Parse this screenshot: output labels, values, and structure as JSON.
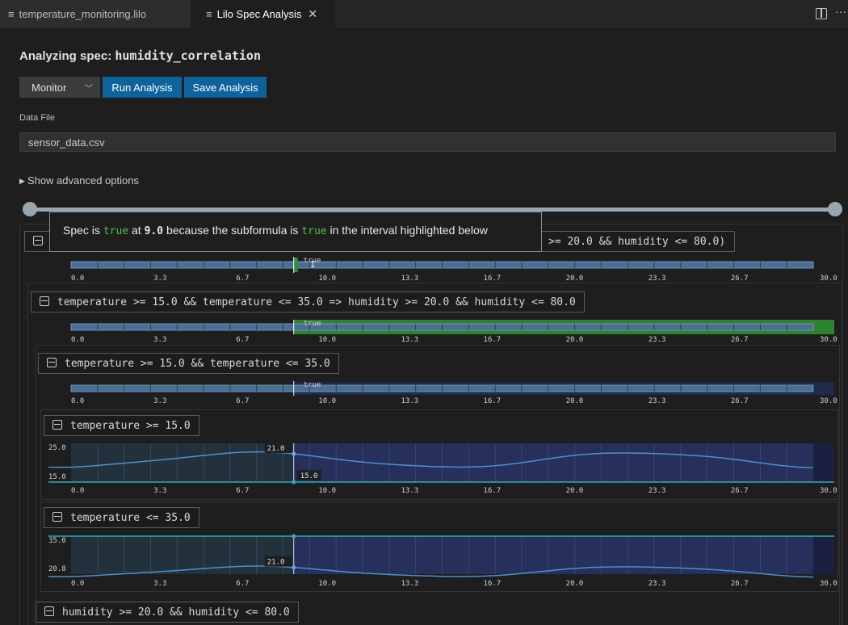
{
  "tabs": [
    {
      "label": "temperature_monitoring.lilo",
      "icon": "text-file-icon",
      "active": false
    },
    {
      "label": "Lilo Spec Analysis",
      "icon": "preview-icon",
      "active": true
    }
  ],
  "title": {
    "prefix": "Analyzing spec: ",
    "spec_name": "humidity_correlation"
  },
  "controls": {
    "mode": "Monitor",
    "run_label": "Run Analysis",
    "save_label": "Save Analysis"
  },
  "data_file": {
    "label": "Data File",
    "value": "sensor_data.csv"
  },
  "advanced_toggle": "Show advanced options",
  "tooltip": {
    "t1": "Spec is ",
    "kw1": "true",
    "t2": " at ",
    "time": "9.0",
    "t3": " because the subformula is ",
    "kw2": "true",
    "t4": " in the interval highlighted below"
  },
  "root_label_visible": ">= 20.0 && humidity <= 80.0)",
  "nodes": {
    "implication": "temperature >= 15.0 && temperature <= 35.0 => humidity >= 20.0 && humidity <= 80.0",
    "temp_range": "temperature >= 15.0 && temperature <= 35.0",
    "temp_ge": "temperature >= 15.0",
    "temp_le": "temperature <= 35.0",
    "humidity_range": "humidity >= 20.0 && humidity <= 80.0"
  },
  "time_axis": [
    "0.0",
    "3.3",
    "6.7",
    "10.0",
    "13.3",
    "16.7",
    "20.0",
    "23.3",
    "26.7",
    "30.0"
  ],
  "marker_label": "true",
  "plots": {
    "temp_ge": {
      "y_max_label": "25.0",
      "y_min_label": "15.0",
      "value_label": "21.0",
      "threshold_label": "15.0"
    },
    "temp_le": {
      "y_max_label": "35.0",
      "y_min_label": "20.8",
      "value_label": "21.0"
    }
  },
  "colors": {
    "accent": "#0e639c",
    "true": "#2f8f2f",
    "signal": "#4f8fcf",
    "threshold": "#27b0b5"
  }
}
